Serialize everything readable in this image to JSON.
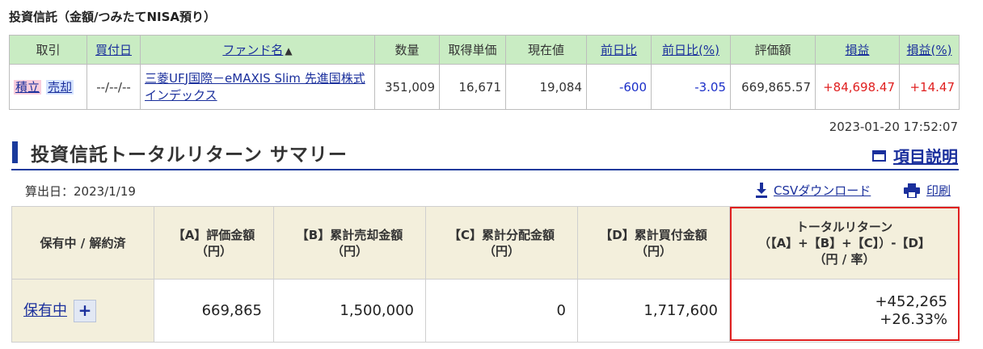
{
  "fund_section": {
    "heading": "投資信託（金額/つみたてNISA預り）",
    "columns": {
      "trade": "取引",
      "buy_date": "買付日",
      "fund_name": "ファンド名",
      "quantity": "数量",
      "avg_cost": "取得単価",
      "current": "現在値",
      "day_change": "前日比",
      "day_change_pct": "前日比(%)",
      "valuation": "評価額",
      "pl": "損益",
      "pl_pct": "損益(%)"
    },
    "row": {
      "buy_label": "積立",
      "sell_label": "売却",
      "buy_date": "--/--/--",
      "fund_name": "三菱UFJ国際－eMAXIS Slim 先進国株式インデックス",
      "quantity": "351,009",
      "avg_cost": "16,671",
      "current": "19,084",
      "day_change": "-600",
      "day_change_pct": "-3.05",
      "valuation": "669,865.57",
      "pl": "+84,698.47",
      "pl_pct": "+14.47"
    }
  },
  "timestamp": "2023-01-20 17:52:07",
  "summary": {
    "title": "投資信託トータルリターン サマリー",
    "help_label": "項目説明",
    "calc_date": "算出日：2023/1/19",
    "csv_label": "CSVダウンロード",
    "print_label": "印刷",
    "headers": {
      "status": "保有中 / 解約済",
      "a_line1": "【A】評価金額",
      "a_line2": "（円）",
      "b_line1": "【B】累計売却金額",
      "b_line2": "（円）",
      "c_line1": "【C】累計分配金額",
      "c_line2": "（円）",
      "d_line1": "【D】累計買付金額",
      "d_line2": "（円）",
      "tr_line1": "トータルリターン",
      "tr_line2": "（【A】+【B】+【C】）-【D】",
      "tr_line3": "（円 / 率）"
    },
    "row": {
      "status_label": "保有中",
      "expand_label": "+",
      "a": "669,865",
      "b": "1,500,000",
      "c": "0",
      "d": "1,717,600",
      "tr_yen": "+452,265",
      "tr_pct": "+26.33%"
    }
  },
  "colors": {
    "header_green": "#c9ecc3",
    "header_beige": "#f3efdc",
    "link_blue": "#1a2f9c",
    "negative_blue": "#1a2ec8",
    "positive_red": "#e02020"
  }
}
